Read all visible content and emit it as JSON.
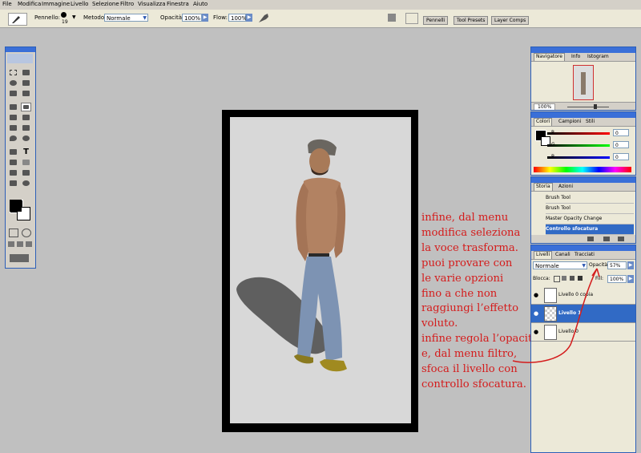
{
  "menu": [
    "File",
    "Modifica",
    "Immagine",
    "Livello",
    "Selezione",
    "Filtro",
    "Visualizza",
    "Finestra",
    "Aiuto"
  ],
  "options": {
    "brush_label": "Pennello:",
    "brush_size": "19",
    "mode_label": "Metodo:",
    "mode_value": "Normale",
    "opacity_label": "Opacità:",
    "opacity_value": "100%",
    "flow_label": "Flow:",
    "flow_value": "100%",
    "panel_tabs": [
      "Pennelli",
      "Tool Presets",
      "Layer Comps"
    ]
  },
  "navigator": {
    "tabs": [
      "Navigatore",
      "Info",
      "Istogram"
    ],
    "zoom": "100%"
  },
  "color": {
    "tabs": [
      "Colori",
      "Campioni",
      "Stili"
    ],
    "channels": [
      "R",
      "G",
      "B"
    ],
    "values": [
      "0",
      "0",
      "0"
    ]
  },
  "history": {
    "tabs": [
      "Storia",
      "Azioni"
    ],
    "items": [
      "Brush Tool",
      "Brush Tool",
      "Master Opacity Change",
      "Controllo sfocatura"
    ],
    "selected": 3
  },
  "layers": {
    "tabs": [
      "Livelli",
      "Canali",
      "Tracciati"
    ],
    "mode": "Normale",
    "opacity_label": "Opacità:",
    "opacity_value": "57%",
    "lock_label": "Blocca:",
    "fill_label": "Fill:",
    "fill_value": "100%",
    "items": [
      "Livello 0 copia",
      "Livello 1",
      "Livello 0"
    ],
    "selected": 1
  },
  "annotation": [
    "infine, dal menu",
    "modifica seleziona",
    "la voce trasforma.",
    "puoi provare con",
    "le varie opzioni",
    "fino a che non",
    "raggiungi l’effetto",
    "voluto.",
    "infine regola l’opacità",
    "e, dal menu filtro,",
    "sfoca il livello con",
    "controllo sfocatura."
  ],
  "colors": {
    "accent": "#316ac5",
    "annotation": "#d41c1c",
    "canvas_frame": "#000000"
  }
}
